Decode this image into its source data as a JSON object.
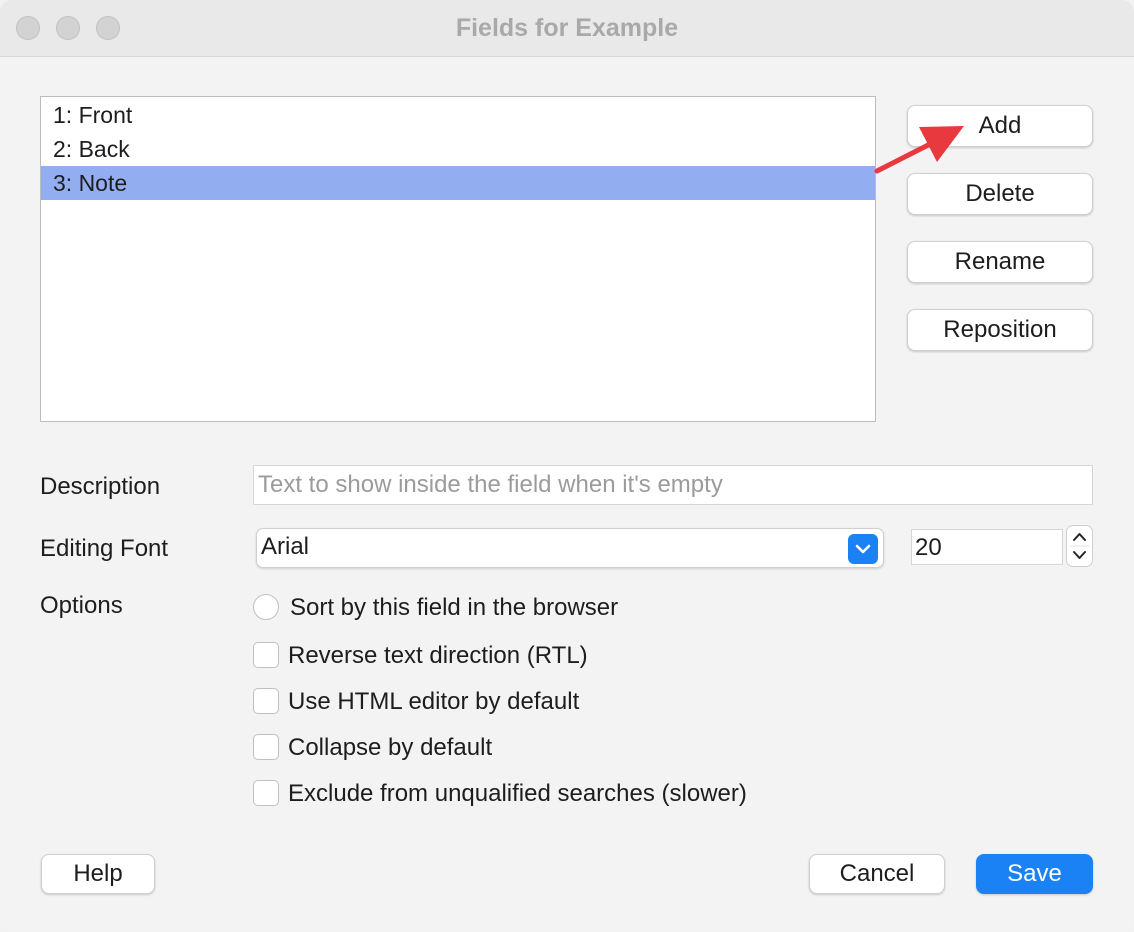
{
  "window": {
    "title": "Fields for Example"
  },
  "fields": [
    {
      "label": "1: Front"
    },
    {
      "label": "2: Back"
    },
    {
      "label": "3: Note"
    }
  ],
  "side_buttons": {
    "add": "Add",
    "delete": "Delete",
    "rename": "Rename",
    "reposition": "Reposition"
  },
  "form": {
    "description_label": "Description",
    "description_placeholder": "Text to show inside the field when it's empty",
    "font_label": "Editing Font",
    "font_value": "Arial",
    "size_value": "20",
    "options_label": "Options"
  },
  "options": {
    "sort": "Sort by this field in the browser",
    "rtl": "Reverse text direction (RTL)",
    "html": "Use HTML editor by default",
    "collapse": "Collapse by default",
    "exclude": "Exclude from unqualified searches (slower)"
  },
  "footer": {
    "help": "Help",
    "cancel": "Cancel",
    "save": "Save"
  },
  "colors": {
    "selection": "#93aef0",
    "accent": "#1a82f5",
    "annotation_arrow": "#e8393f"
  },
  "icons": {
    "dropdown": "chevron-down-icon",
    "stepper": "up-down-stepper-icon",
    "annotation": "red-arrow"
  }
}
